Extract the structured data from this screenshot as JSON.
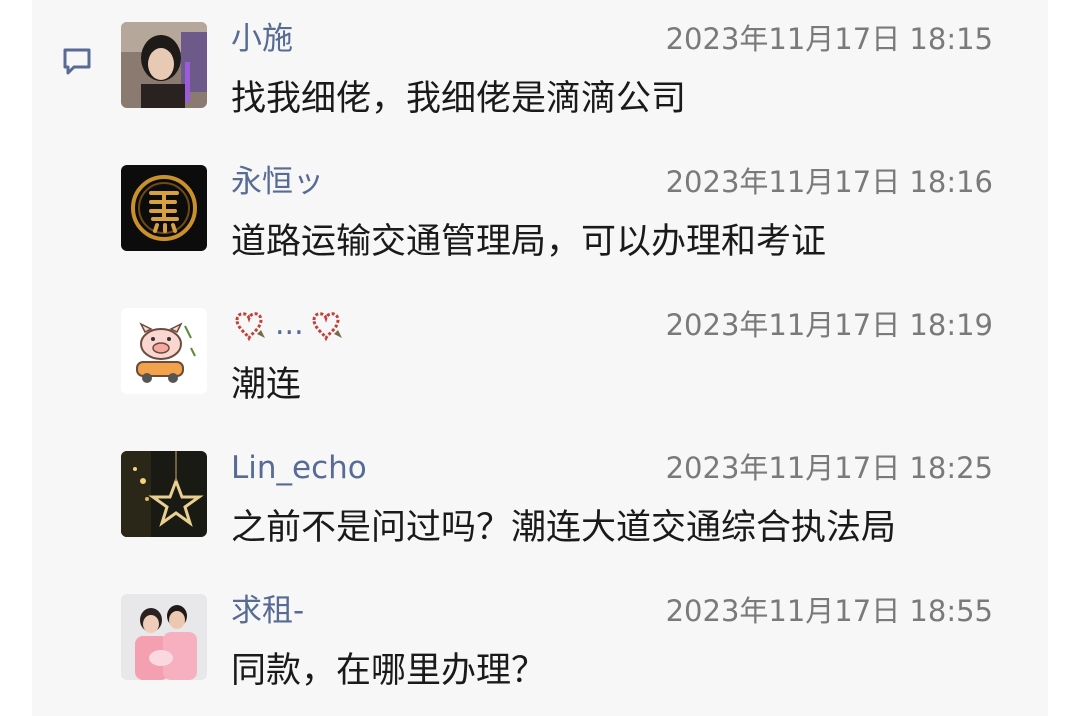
{
  "comments": [
    {
      "name": "小施",
      "time": "2023年11月17日 18:15",
      "text": "找我细佬，我细佬是滴滴公司",
      "avatar": "woman-photo-avatar"
    },
    {
      "name": "永恒ッ",
      "time": "2023年11月17日 18:16",
      "text": "道路运输交通管理局，可以办理和考证",
      "avatar": "horse-character-avatar"
    },
    {
      "name_ellipsis": "...",
      "time": "2023年11月17日 18:19",
      "text": "潮连",
      "avatar": "pig-cartoon-avatar"
    },
    {
      "name": "Lin_echo",
      "time": "2023年11月17日 18:25",
      "text": "之前不是问过吗？潮连大道交通综合执法局",
      "avatar": "star-light-avatar"
    },
    {
      "name": "求租-",
      "time": "2023年11月17日 18:55",
      "text": "同款，在哪里办理？",
      "avatar": "couple-photo-avatar"
    }
  ],
  "colors": {
    "name": "#576b95",
    "time": "#7a7a7a",
    "text": "#1a1a1a",
    "panel": "#f7f7f7"
  }
}
